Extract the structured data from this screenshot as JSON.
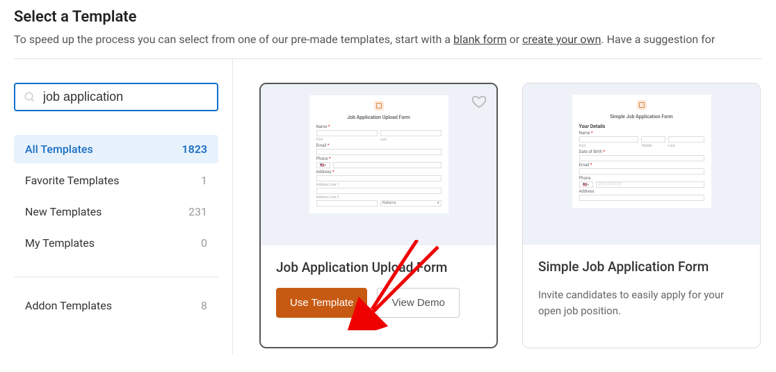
{
  "header": {
    "title": "Select a Template",
    "subtitle_pre": "To speed up the process you can select from one of our pre-made templates, start with a ",
    "link_blank": "blank form",
    "subtitle_mid": " or ",
    "link_create": "create your own",
    "subtitle_post": ". Have a suggestion for"
  },
  "search": {
    "value": "job application"
  },
  "categories": [
    {
      "label": "All Templates",
      "count": "1823",
      "active": true
    },
    {
      "label": "Favorite Templates",
      "count": "1",
      "active": false
    },
    {
      "label": "New Templates",
      "count": "231",
      "active": false
    },
    {
      "label": "My Templates",
      "count": "0",
      "active": false
    }
  ],
  "addon": {
    "label": "Addon Templates",
    "count": "8"
  },
  "card1": {
    "preview_title": "Job Application Upload Form",
    "labels": {
      "name": "Name",
      "email": "Email",
      "phone": "Phone",
      "address": "Address",
      "first": "First",
      "last": "Last",
      "addr1": "Address Line 1",
      "addr2": "Address Line 2",
      "state": "Alabama"
    },
    "title": "Job Application Upload Form",
    "use_btn": "Use Template",
    "demo_btn": "View Demo"
  },
  "card2": {
    "preview_title": "Simple Job Application Form",
    "labels": {
      "section": "Your Details",
      "name": "Name",
      "first": "First",
      "middle": "Middle",
      "last": "Last",
      "dob": "Date of Birth",
      "email": "Email",
      "phone": "Phone",
      "phone_ph": "(201) 555-0123",
      "address": "Address"
    },
    "title": "Simple Job Application Form",
    "desc": "Invite candidates to easily apply for your open job position."
  }
}
